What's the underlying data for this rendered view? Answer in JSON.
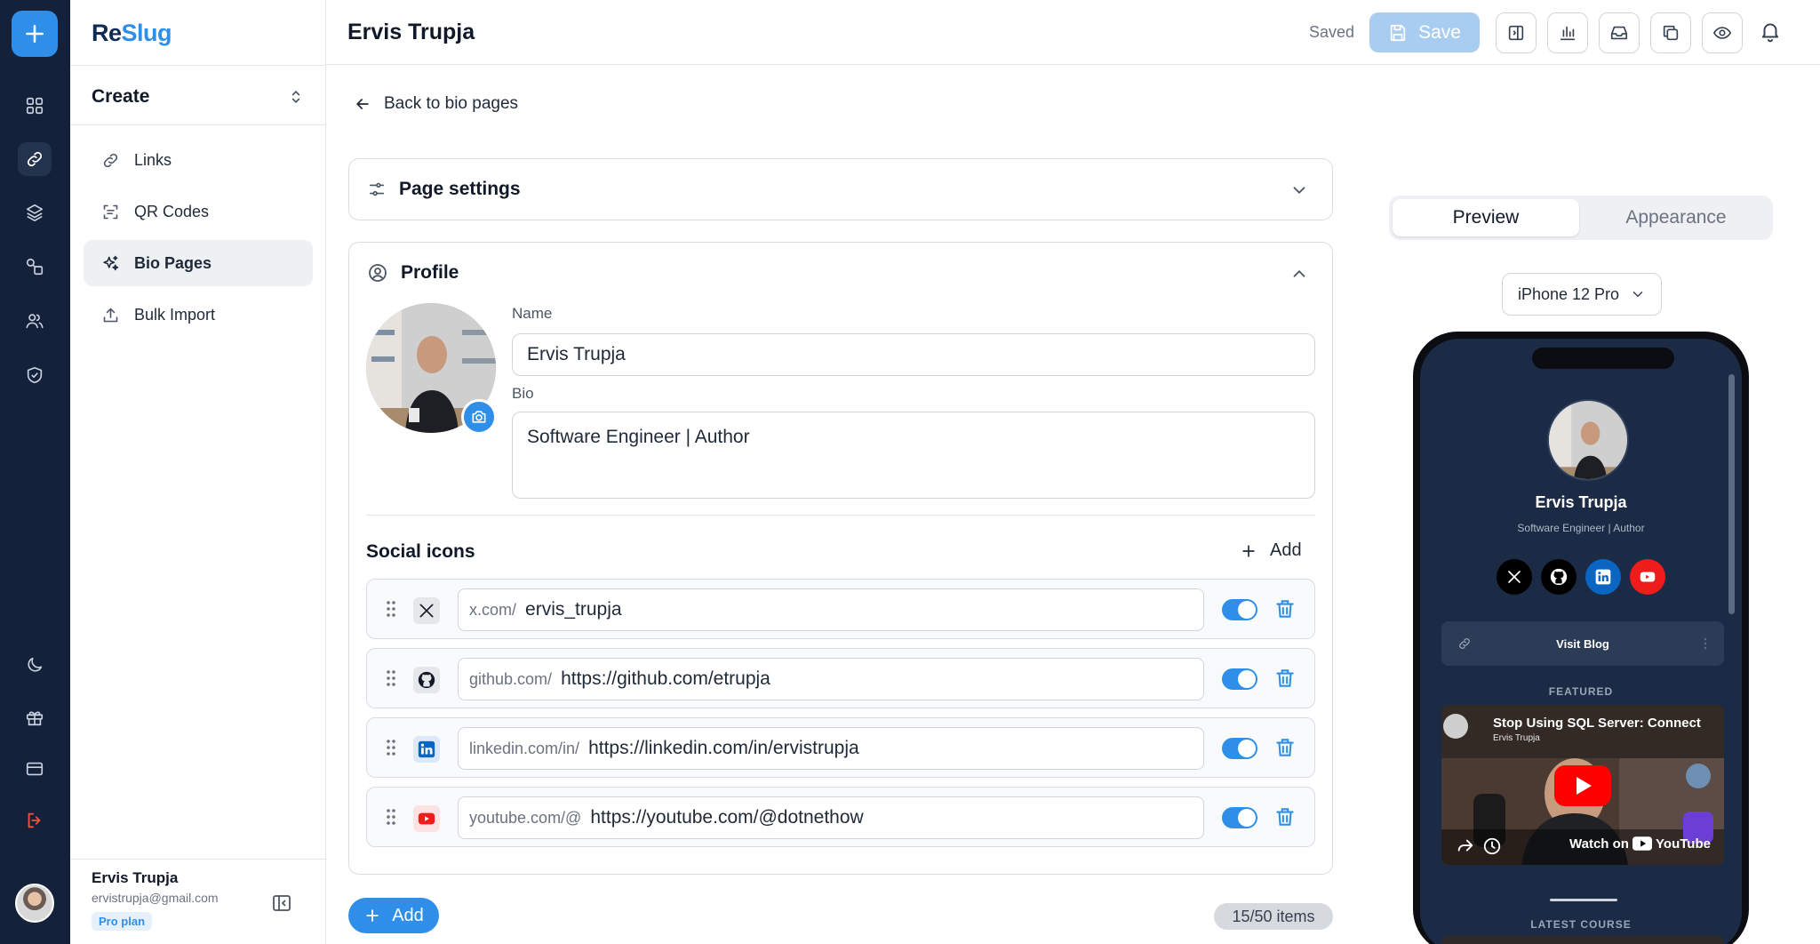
{
  "rail": {
    "items": [
      "add",
      "dashboard",
      "links",
      "layers",
      "shapes",
      "users",
      "shield",
      "moon",
      "gift",
      "card",
      "logout"
    ]
  },
  "brand": {
    "part1": "Re",
    "part2": "Slug"
  },
  "sidebar": {
    "section": "Create",
    "items": [
      {
        "label": "Links",
        "icon": "link-icon"
      },
      {
        "label": "QR Codes",
        "icon": "qr-code-icon"
      },
      {
        "label": "Bio Pages",
        "icon": "sparkles-icon",
        "active": true
      },
      {
        "label": "Bulk Import",
        "icon": "upload-icon"
      }
    ],
    "user": {
      "name": "Ervis Trupja",
      "email": "ervistrupja@gmail.com",
      "plan": "Pro plan"
    }
  },
  "topbar": {
    "title": "Ervis Trupja",
    "status": "Saved",
    "save_label": "Save"
  },
  "main": {
    "back_label": "Back to bio pages",
    "page_settings_title": "Page settings",
    "profile": {
      "title": "Profile",
      "name_label": "Name",
      "name_value": "Ervis Trupja",
      "bio_label": "Bio",
      "bio_value": "Software Engineer | Author"
    },
    "social": {
      "title": "Social icons",
      "add_label": "Add",
      "rows": [
        {
          "prefix": "x.com/",
          "value": "ervis_trupja",
          "enabled": true
        },
        {
          "prefix": "github.com/",
          "value": "https://github.com/etrupja",
          "enabled": true
        },
        {
          "prefix": "linkedin.com/in/",
          "value": "https://linkedin.com/in/ervistrupja",
          "enabled": true
        },
        {
          "prefix": "youtube.com/@",
          "value": "https://youtube.com/@dotnethow",
          "enabled": true
        }
      ]
    },
    "add_block_label": "Add",
    "items_count": "15/50 items"
  },
  "preview": {
    "tabs": [
      "Preview",
      "Appearance"
    ],
    "device": "iPhone 12 Pro",
    "phone": {
      "name": "Ervis Trupja",
      "bio": "Software Engineer | Author",
      "link_label": "Visit Blog",
      "featured_label": "FEATURED",
      "video_title": "Stop Using SQL Server: Connect",
      "video_channel": "Ervis Trupja",
      "watch_on": "Watch on",
      "youtube_word": "YouTube",
      "latest_label": "LATEST COURSE"
    }
  },
  "colors": {
    "accent": "#2f8fe8",
    "rail": "#14213a",
    "phone_bg": "#1c2b45"
  }
}
